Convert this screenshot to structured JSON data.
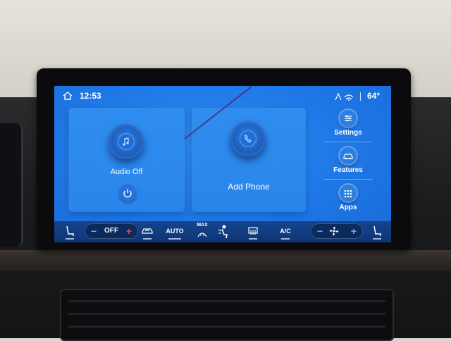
{
  "status_bar": {
    "time": "12:53",
    "temperature": "64°"
  },
  "tiles": {
    "audio": {
      "label": "Audio Off"
    },
    "phone": {
      "label": "Add Phone"
    }
  },
  "side_menu": {
    "items": [
      {
        "label": "Settings",
        "icon": "settings-icon"
      },
      {
        "label": "Features",
        "icon": "car-icon"
      },
      {
        "label": "Apps",
        "icon": "apps-grid-icon"
      }
    ]
  },
  "climate": {
    "left_temp_label": "OFF",
    "minus": "−",
    "plus": "+",
    "auto_label": "AUTO",
    "max_label": "MAX",
    "ac_label": "A/C"
  },
  "colors": {
    "screen_blue": "#1e77e6",
    "climate_bar": "#0f3573",
    "plus_red": "#ff3b30",
    "minus_blue": "#6fb0ff"
  }
}
